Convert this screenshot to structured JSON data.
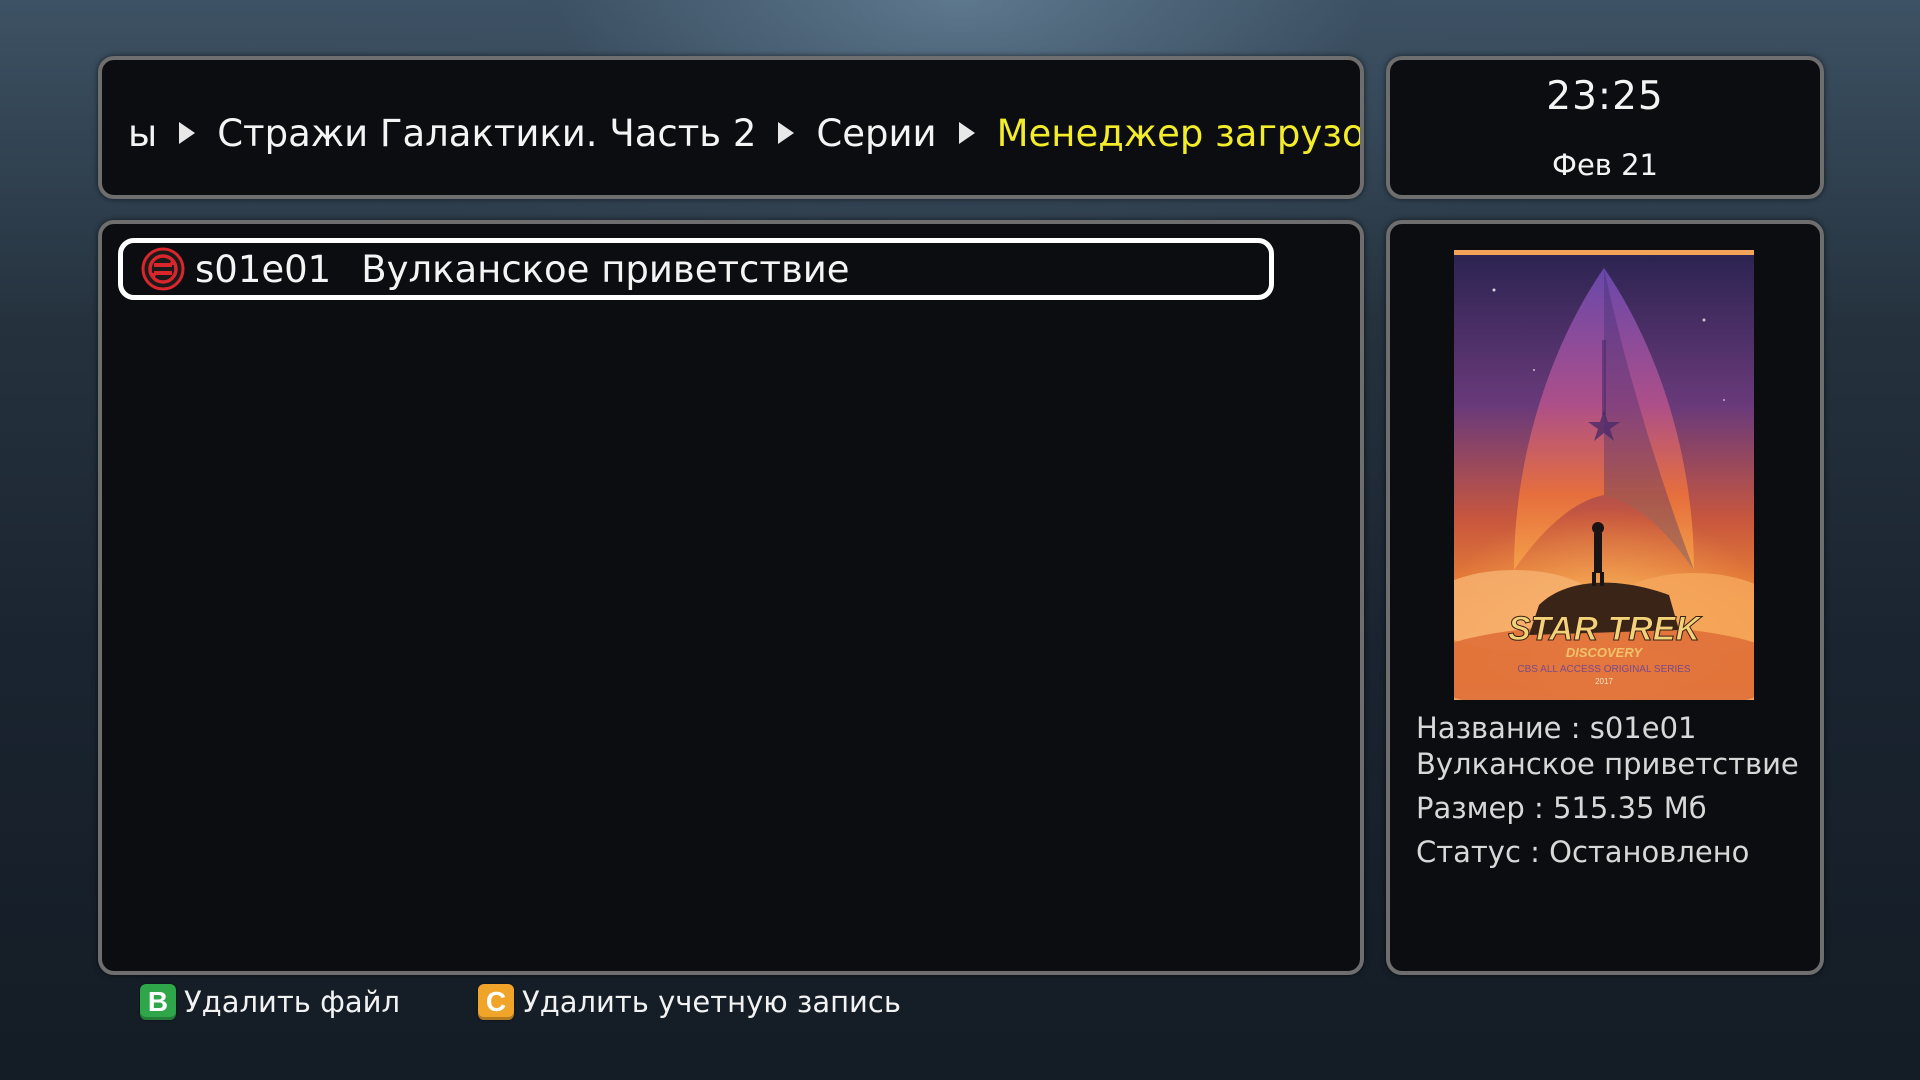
{
  "header": {
    "breadcrumb": [
      "ы",
      "Стражи Галактики. Часть 2",
      "Серии",
      "Менеджер загрузок"
    ],
    "current_color": "#f2ec2a"
  },
  "clock": {
    "time": "23:25",
    "date": "Фев 21"
  },
  "list": {
    "items": [
      {
        "code": "s01e01",
        "title": "Вулканское приветствие",
        "status_icon": "stopped-status-icon",
        "selected": true
      }
    ]
  },
  "info": {
    "poster": {
      "title_art": "STAR TREK",
      "subtitle_art": "DISCOVERY",
      "tagline_art": "CBS ALL ACCESS ORIGINAL SERIES",
      "year_art": "2017"
    },
    "name_label": "Название : s01e01",
    "name_cont": "Вулканское приветствие",
    "size_label": "Размер : 515.35 Мб",
    "status_label": "Статус : Остановлено"
  },
  "footer": {
    "actions": [
      {
        "key": "B",
        "label": "Удалить файл",
        "color": "#2fa64a"
      },
      {
        "key": "C",
        "label": "Удалить учетную запись",
        "color": "#f0a52a"
      }
    ]
  }
}
